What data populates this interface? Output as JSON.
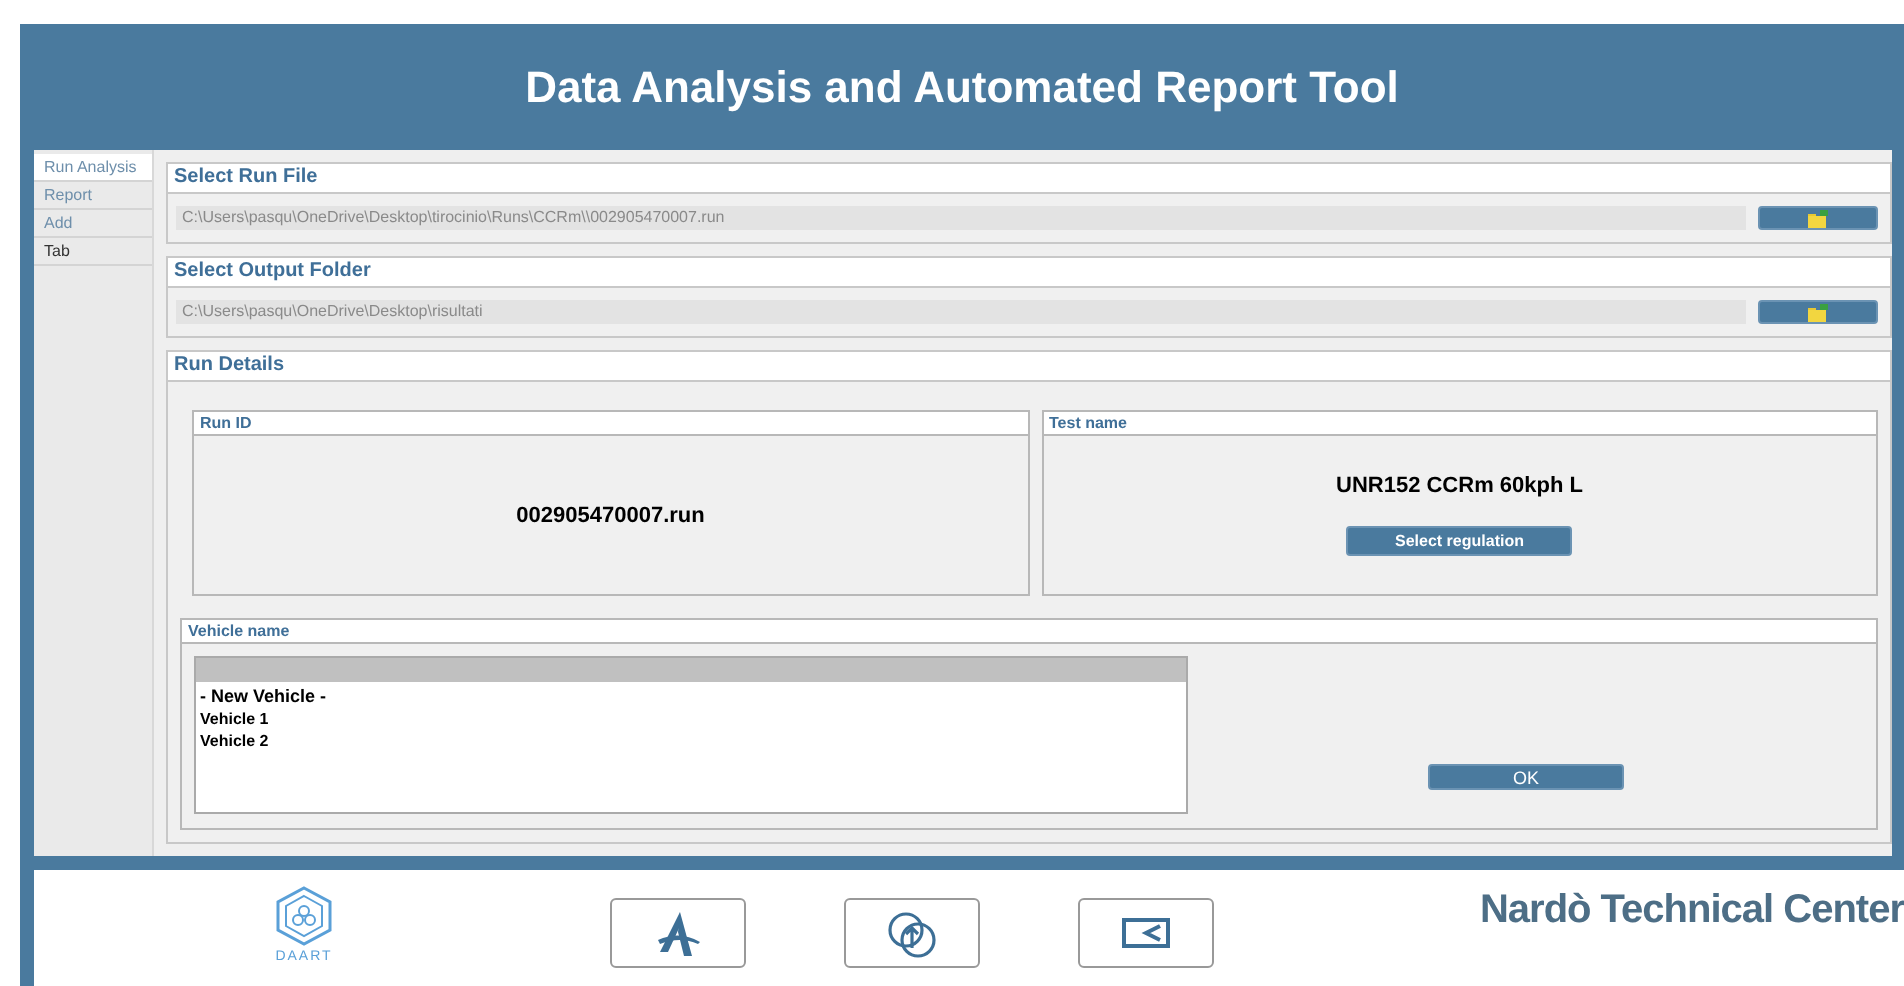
{
  "window": {
    "title": "Data Analysis and Automated Report Tool"
  },
  "sidebar": {
    "items": [
      {
        "label": "Run Analysis",
        "selected": true,
        "kind": "page"
      },
      {
        "label": "Report",
        "selected": false,
        "kind": "page"
      },
      {
        "label": "Add",
        "selected": false,
        "kind": "page"
      },
      {
        "label": "Tab",
        "selected": false,
        "kind": "new"
      }
    ]
  },
  "run_file": {
    "title": "Select Run File",
    "value": "C:\\Users\\pasqu\\OneDrive\\Desktop\\tirocinio\\Runs\\CCRm\\\\002905470007.run"
  },
  "output_folder": {
    "title": "Select Output Folder",
    "value": "C:\\Users\\pasqu\\OneDrive\\Desktop\\risultati"
  },
  "run_details": {
    "title": "Run Details",
    "run_id": {
      "title": "Run ID",
      "value": "002905470007.run"
    },
    "test_name": {
      "title": "Test name",
      "value": "UNR152 CCRm 60kph L",
      "button": "Select regulation"
    },
    "vehicle": {
      "title": "Vehicle name",
      "items": [
        "- New Vehicle -",
        "Vehicle 1",
        "Vehicle 2"
      ],
      "button": "OK"
    }
  },
  "footer": {
    "logo": "DAART",
    "brand": "Nardò Technical Center"
  }
}
